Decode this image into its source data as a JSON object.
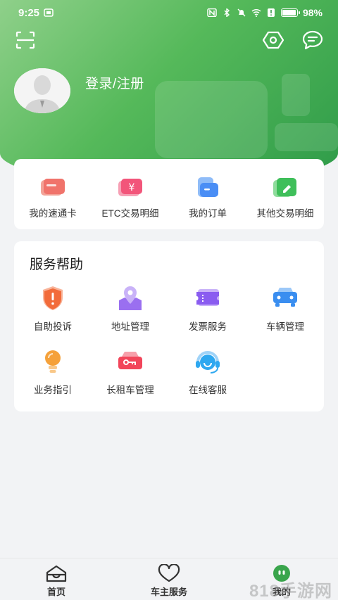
{
  "status_bar": {
    "time": "9:25",
    "battery": "98%",
    "battery_level": 0.98
  },
  "header": {
    "login_text": "登录/注册"
  },
  "quick_actions": [
    {
      "label": "我的速通卡",
      "icon": "card-icon",
      "color": "#f0736b"
    },
    {
      "label": "ETC交易明细",
      "icon": "yuan-icon",
      "color": "#f2557a"
    },
    {
      "label": "我的订单",
      "icon": "wallet-icon",
      "color": "#4a8ef5"
    },
    {
      "label": "其他交易明细",
      "icon": "edit-card-icon",
      "color": "#3fbf5a"
    }
  ],
  "services": {
    "title": "服务帮助",
    "items": [
      {
        "label": "自助投诉",
        "icon": "shield-alert-icon",
        "color": "#f26b3a"
      },
      {
        "label": "地址管理",
        "icon": "map-pin-icon",
        "color": "#9a6ff0"
      },
      {
        "label": "发票服务",
        "icon": "ticket-icon",
        "color": "#8a5cf0"
      },
      {
        "label": "车辆管理",
        "icon": "car-icon",
        "color": "#3a8ef0"
      },
      {
        "label": "业务指引",
        "icon": "lightbulb-icon",
        "color": "#f5a13a"
      },
      {
        "label": "长租车管理",
        "icon": "car-key-icon",
        "color": "#f2455a"
      },
      {
        "label": "在线客服",
        "icon": "headset-icon",
        "color": "#2ea8f0"
      }
    ]
  },
  "tabbar": {
    "items": [
      {
        "label": "首页",
        "icon": "home-icon"
      },
      {
        "label": "车主服务",
        "icon": "heart-icon"
      },
      {
        "label": "我的",
        "icon": "profile-icon",
        "active": true
      }
    ]
  },
  "watermark": "818手游网"
}
